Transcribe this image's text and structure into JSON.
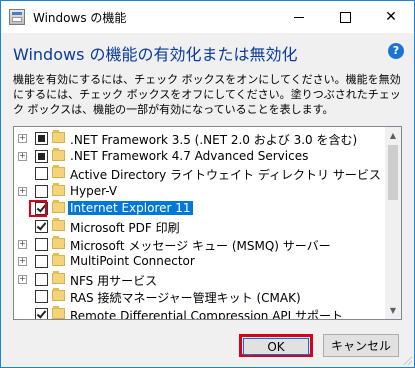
{
  "window": {
    "title": "Windows の機能",
    "minimize_icon": "minimize-icon",
    "maximize_icon": "maximize-icon",
    "close_icon": "close-icon",
    "close_glyph": "✕"
  },
  "heading": "Windows の機能の有効化または無効化",
  "help_label": "?",
  "description": "機能を有効にするには、チェック ボックスをオンにしてください。機能を無効にするには、チェック ボックスをオフにしてください。塗りつぶされたチェック ボックスは、機能の一部が有効になっていることを表します。",
  "features": [
    {
      "label": ".NET Framework 3.5 (.NET 2.0 および 3.0 を含む)",
      "expandable": true,
      "state": "partial"
    },
    {
      "label": ".NET Framework 4.7 Advanced Services",
      "expandable": true,
      "state": "partial"
    },
    {
      "label": "Active Directory ライトウェイト ディレクトリ サービス",
      "expandable": false,
      "state": "unchecked"
    },
    {
      "label": "Hyper-V",
      "expandable": true,
      "state": "unchecked"
    },
    {
      "label": "Internet Explorer 11",
      "expandable": false,
      "state": "checked",
      "selected": true
    },
    {
      "label": "Microsoft PDF 印刷",
      "expandable": false,
      "state": "checked"
    },
    {
      "label": "Microsoft メッセージ キュー (MSMQ) サーバー",
      "expandable": true,
      "state": "unchecked"
    },
    {
      "label": "MultiPoint Connector",
      "expandable": true,
      "state": "unchecked"
    },
    {
      "label": "NFS 用サービス",
      "expandable": true,
      "state": "unchecked"
    },
    {
      "label": "RAS 接続マネージャー管理キット (CMAK)",
      "expandable": false,
      "state": "unchecked"
    },
    {
      "label": "Remote Differential Compression API サポート",
      "expandable": false,
      "state": "checked"
    }
  ],
  "buttons": {
    "ok": "OK",
    "cancel": "キャンセル"
  },
  "colors": {
    "accent": "#0078d7",
    "heading": "#0a3b9d",
    "highlight": "#d9001b"
  }
}
